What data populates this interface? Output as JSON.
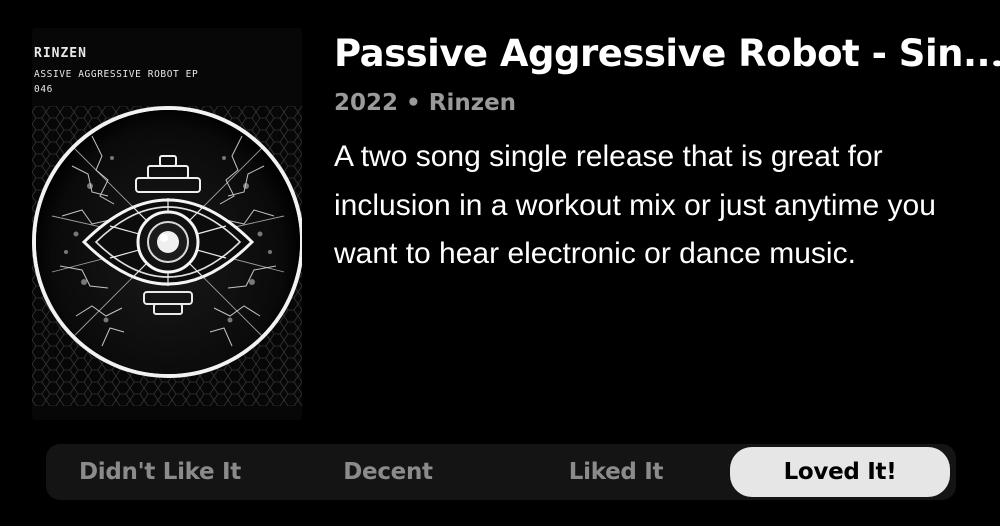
{
  "album": {
    "title": "Passive Aggressive Robot - Sin..♪",
    "meta": "2022 • Rinzen",
    "description": "A two song single release that is great for inclusion in a workout mix or just anytime you want to hear electronic or dance music.",
    "art": {
      "artist_text": "RINZEN",
      "release_text": "ASSIVE AGGRESSIVE ROBOT EP",
      "catalog_text": "046"
    }
  },
  "rating": {
    "options": [
      {
        "label": "Didn't Like It",
        "selected": false
      },
      {
        "label": "Decent",
        "selected": false
      },
      {
        "label": "Liked It",
        "selected": false
      },
      {
        "label": "Loved It!",
        "selected": true
      }
    ]
  },
  "colors": {
    "background": "#000000",
    "title": "#ffffff",
    "meta": "#9a9a9a",
    "rating_bar": "#141414",
    "rating_selected_bg": "#e6e6e6",
    "rating_unselected_text": "#8b8b8b"
  }
}
